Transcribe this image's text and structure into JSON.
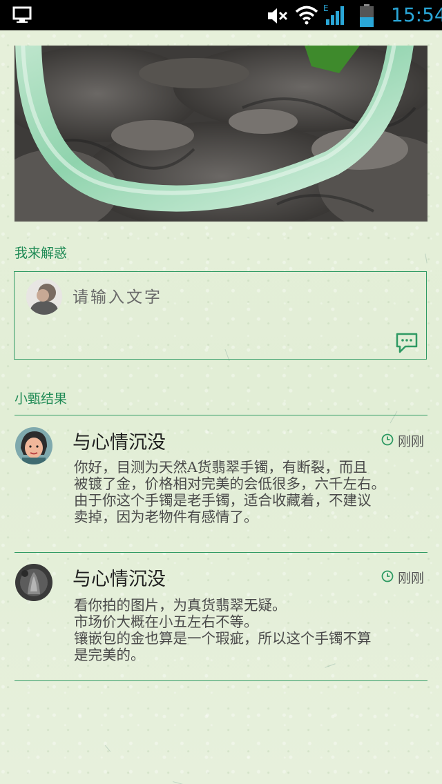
{
  "status_bar": {
    "time": "15:54",
    "network_type": "E",
    "icons": [
      "desktop-icon",
      "mute-icon",
      "wifi-icon",
      "signal-icon",
      "battery-icon"
    ],
    "time_color": "#2aa7d8"
  },
  "banner": {
    "image": "jade-bangle-photo"
  },
  "reply_section": {
    "title": "我来解惑",
    "input_placeholder": "请输入文字",
    "input_value": "",
    "send_icon": "comment-icon"
  },
  "results_section": {
    "title": "小甄结果"
  },
  "comments": [
    {
      "name": "与心情沉没",
      "time": "刚刚",
      "body": "你好，目测为天然A货翡翠手镯，有断裂，而且\n被镀了金，价格相对完美的会低很多，六千左右。\n由于你这个手镯是老手镯，适合收藏着，不建议\n卖掉，因为老物件有感情了。"
    },
    {
      "name": "与心情沉没",
      "time": "刚刚",
      "body": "看你拍的图片，为真货翡翠无疑。\n市场价大概在小五左右不等。\n镶嵌包的金也算是一个瑕疵，所以这个手镯不算\n是完美的。"
    }
  ],
  "colors": {
    "accent": "#2f9a63",
    "background": "#e4efd8",
    "status_bar": "#000000"
  }
}
